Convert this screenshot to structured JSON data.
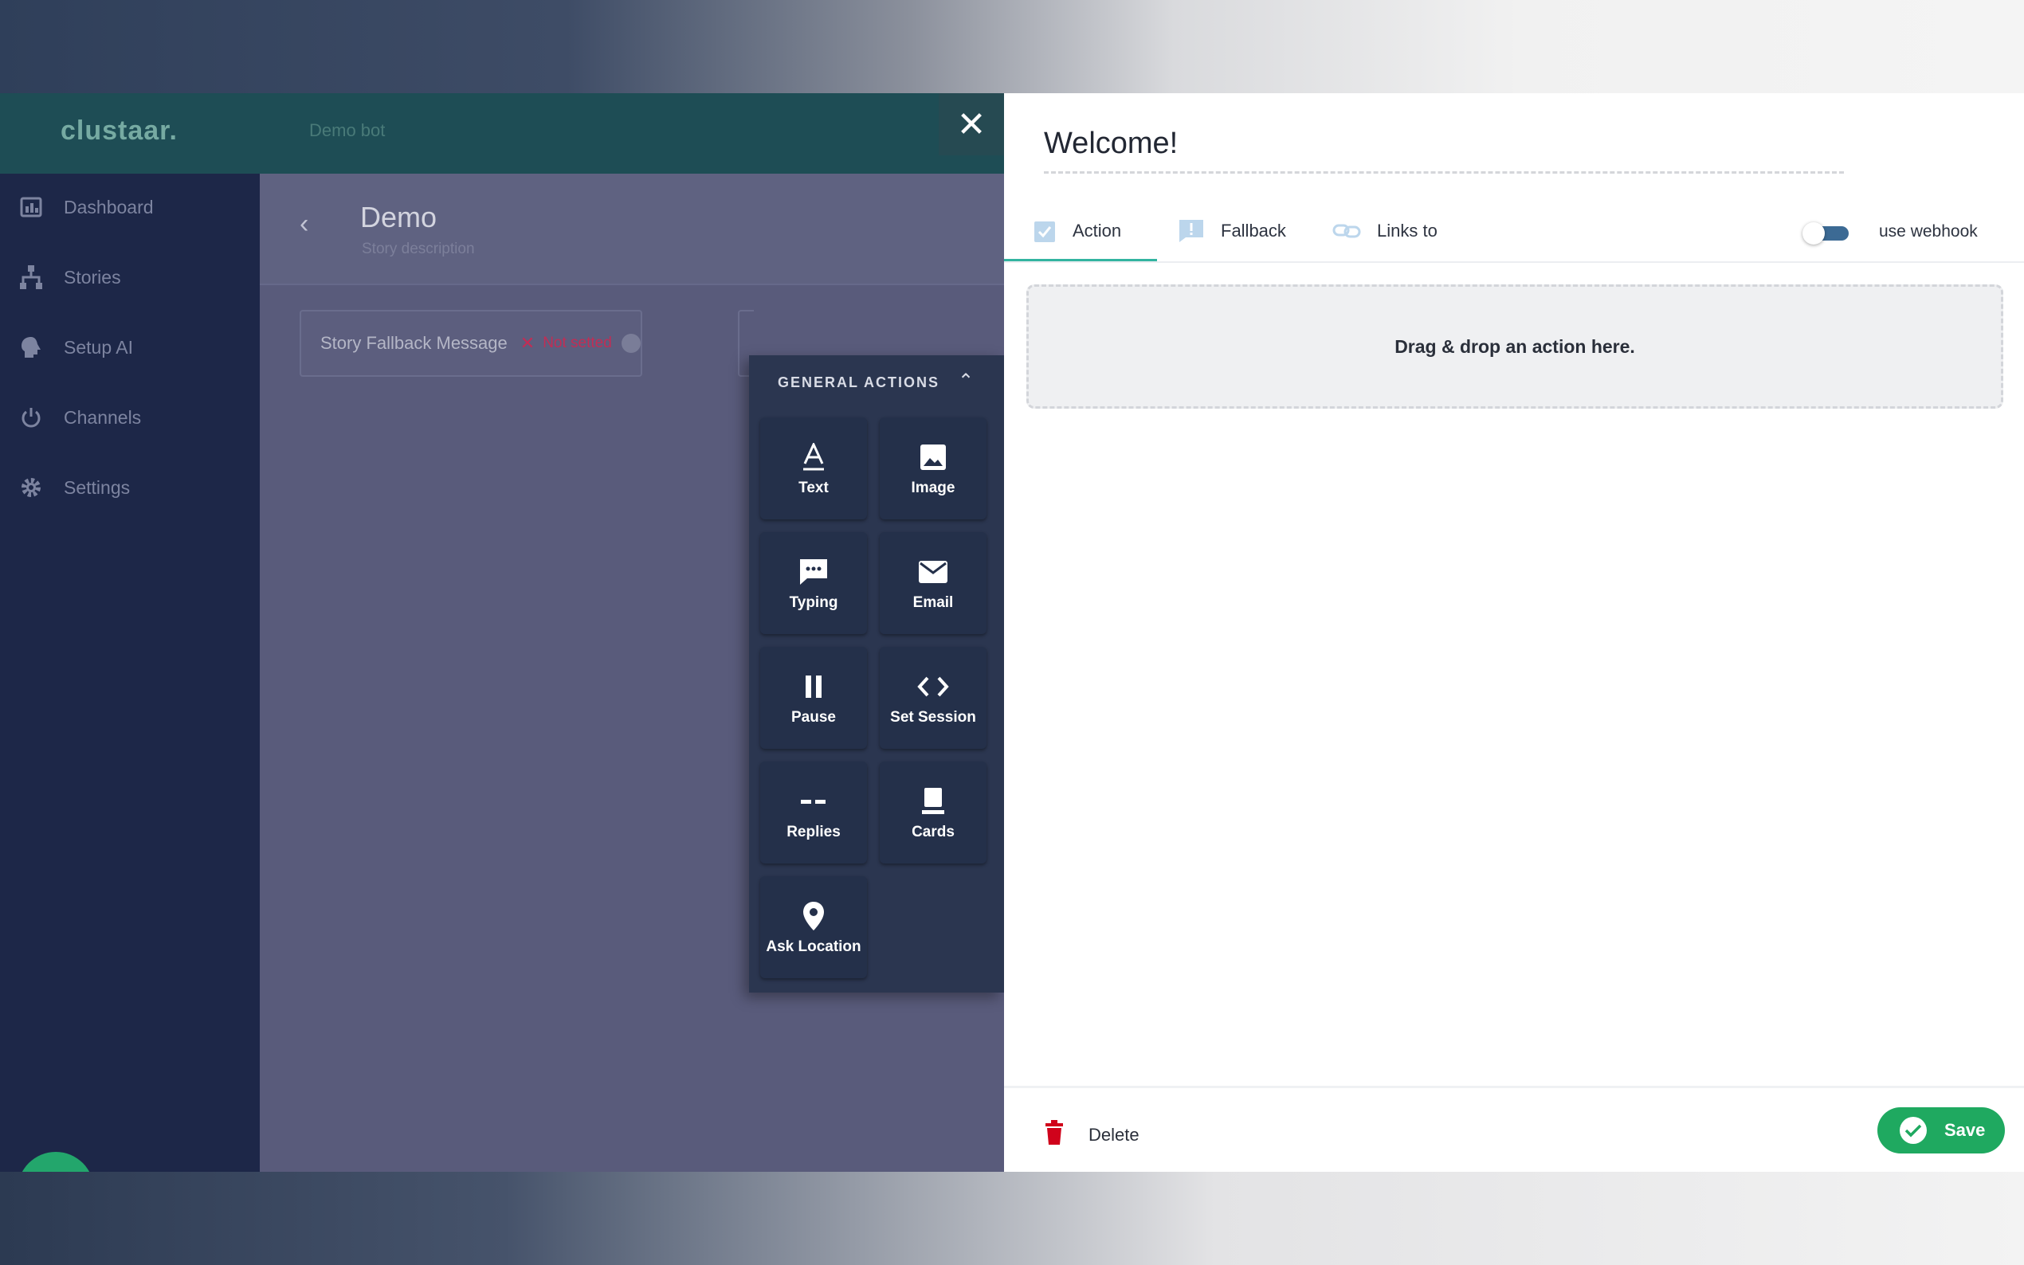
{
  "app": {
    "logo": "clustaar.",
    "bot_name": "Demo bot",
    "close_symbol": "✕"
  },
  "sidebar": {
    "items": [
      {
        "label": "Dashboard",
        "icon": "dashboard-icon"
      },
      {
        "label": "Stories",
        "icon": "stories-icon"
      },
      {
        "label": "Setup AI",
        "icon": "brain-icon"
      },
      {
        "label": "Channels",
        "icon": "power-icon"
      },
      {
        "label": "Settings",
        "icon": "gear-icon"
      }
    ]
  },
  "story": {
    "back_symbol": "‹",
    "title": "Demo",
    "description": "Story description",
    "fallback_label": "Story Fallback Message",
    "fallback_x": "✕",
    "fallback_status": "Not setted"
  },
  "actions_panel": {
    "title": "GENERAL ACTIONS",
    "collapse_symbol": "⌃",
    "tiles": [
      {
        "label": "Text",
        "icon": "text-icon"
      },
      {
        "label": "Image",
        "icon": "image-icon"
      },
      {
        "label": "Typing",
        "icon": "typing-icon"
      },
      {
        "label": "Email",
        "icon": "email-icon"
      },
      {
        "label": "Pause",
        "icon": "pause-icon"
      },
      {
        "label": "Set Session",
        "icon": "code-icon"
      },
      {
        "label": "Replies",
        "icon": "replies-icon"
      },
      {
        "label": "Cards",
        "icon": "cards-icon"
      },
      {
        "label": "Ask Location",
        "icon": "location-pin-icon"
      }
    ]
  },
  "editor": {
    "title": "Welcome!",
    "tabs": [
      {
        "label": "Action",
        "icon": "checkbox-icon",
        "active": true
      },
      {
        "label": "Fallback",
        "icon": "alert-icon",
        "active": false
      },
      {
        "label": "Links to",
        "icon": "link-icon",
        "active": false
      }
    ],
    "webhook_label": "use webhook",
    "webhook_enabled": false,
    "dropzone_text": "Drag & drop an action here.",
    "delete_label": "Delete",
    "save_label": "Save"
  },
  "colors": {
    "accent": "#32b4a0",
    "save_green": "#1fa960",
    "delete_red": "#d0021b",
    "header_teal": "#1e4d55",
    "sidebar_navy": "#1d2748",
    "panel_dark": "#2b3650"
  }
}
